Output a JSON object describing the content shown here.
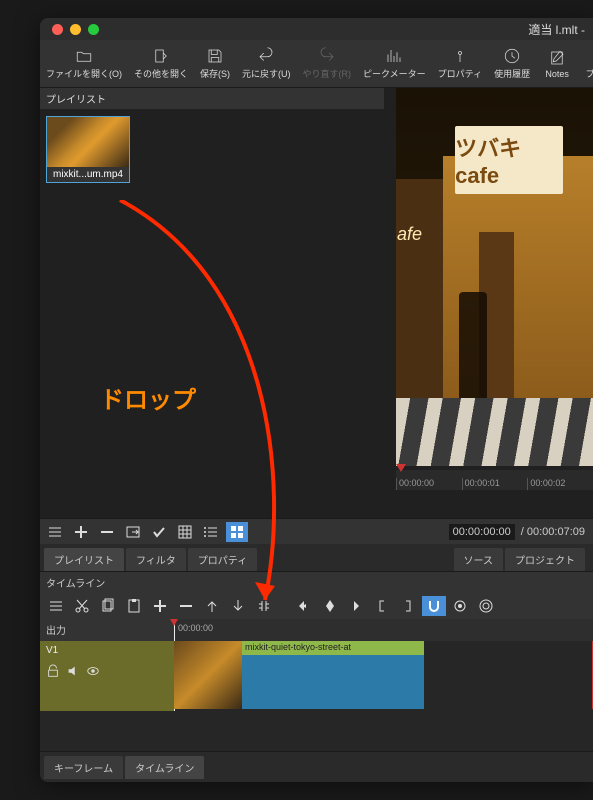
{
  "window": {
    "title": "適当 l.mlt - "
  },
  "toolbar": [
    {
      "key": "open",
      "label": "ファイルを開く(O)"
    },
    {
      "key": "openother",
      "label": "その他を開く"
    },
    {
      "key": "save",
      "label": "保存(S)"
    },
    {
      "key": "undo",
      "label": "元に戻す(U)"
    },
    {
      "key": "redo",
      "label": "やり直す(R)"
    },
    {
      "key": "peak",
      "label": "ピークメーター"
    },
    {
      "key": "prop",
      "label": "プロパティ"
    },
    {
      "key": "history",
      "label": "使用履歴"
    },
    {
      "key": "notes",
      "label": "Notes"
    },
    {
      "key": "playlist",
      "label": "プレイ"
    }
  ],
  "playlist": {
    "title": "プレイリスト",
    "items": [
      {
        "name": "mixkit...um.mp4"
      }
    ]
  },
  "annotation": {
    "drop": "ドロップ"
  },
  "preview": {
    "sign": "ツバキcafe",
    "cafe": "afe"
  },
  "ruler": [
    "00:00:00",
    "00:00:01",
    "00:00:02"
  ],
  "timecode": {
    "current": "00:00:00:00",
    "total": "/ 00:00:07:09"
  },
  "leftTabs": [
    "プレイリスト",
    "フィルタ",
    "プロパティ"
  ],
  "rightTabs": [
    "ソース",
    "プロジェクト"
  ],
  "timeline": {
    "title": "タイムライン",
    "output": "出力",
    "track": "V1",
    "rulerStart": "00:00:00",
    "clipLabel": "mixkit-quiet-tokyo-street-at"
  },
  "bottomTabs": [
    "キーフレーム",
    "タイムライン"
  ]
}
